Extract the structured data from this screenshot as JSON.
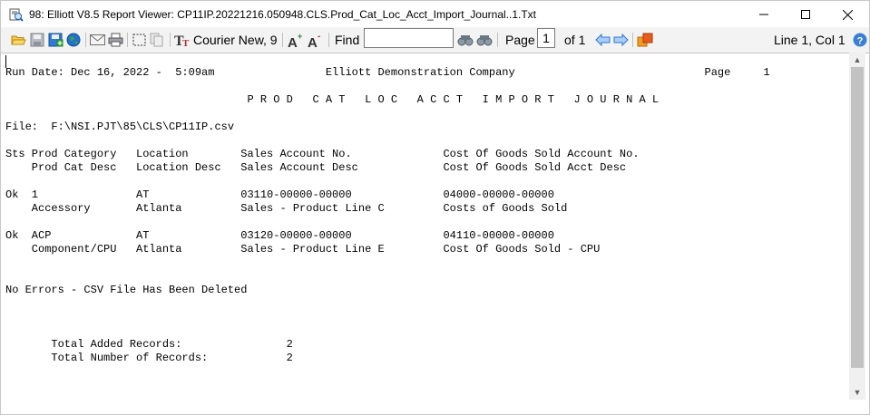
{
  "window": {
    "title": "98: Elliott V8.5 Report Viewer: CP11IP.20221216.050948.CLS.Prod_Cat_Loc_Acct_Import_Journal..1.Txt"
  },
  "toolbar": {
    "font_label": "Courier New, 9",
    "find_label": "Find",
    "find_value": "",
    "page_label": "Page",
    "page_value": "1",
    "page_total": "of 1",
    "cursor_status": "Line 1, Col 1"
  },
  "report": {
    "lines": [
      "Run Date: Dec 16, 2022 -  5:09am                 Elliott Demonstration Company                             Page     1",
      "",
      "                                     P R O D   C A T   L O C   A C C T   I M P O R T   J O U R N A L",
      "",
      "File:  F:\\NSI.PJT\\85\\CLS\\CP11IP.csv",
      "",
      "Sts Prod Category   Location        Sales Account No.              Cost Of Goods Sold Account No.",
      "    Prod Cat Desc   Location Desc   Sales Account Desc             Cost Of Goods Sold Acct Desc",
      "",
      "Ok  1               AT              03110-00000-00000              04000-00000-00000",
      "    Accessory       Atlanta         Sales - Product Line C         Costs of Goods Sold",
      "",
      "Ok  ACP             AT              03120-00000-00000              04110-00000-00000",
      "    Component/CPU   Atlanta         Sales - Product Line E         Cost Of Goods Sold - CPU",
      "",
      "",
      "No Errors - CSV File Has Been Deleted",
      "",
      "",
      "",
      "       Total Added Records:                2",
      "       Total Number of Records:            2"
    ]
  },
  "icons": {
    "app": "report-viewer-icon",
    "open": "folder-open-icon",
    "save": "save-icon",
    "save_as": "save-as-icon",
    "web": "globe-icon",
    "email": "email-icon",
    "print": "printer-icon",
    "select_all": "select-all-icon",
    "copy": "copy-icon",
    "font": "font-icon",
    "font_larger": "font-larger-icon",
    "font_smaller": "font-smaller-icon",
    "find_prev": "find-previous-icon",
    "find_next": "find-next-icon",
    "page_prev": "arrow-left-icon",
    "page_next": "arrow-right-icon",
    "export": "export-icon",
    "help": "help-icon"
  },
  "colors": {
    "toolbar_bg": "#f3f3f3",
    "accent_blue": "#1e73d0",
    "help_blue": "#3b7fd4",
    "orange": "#f29b1e"
  }
}
